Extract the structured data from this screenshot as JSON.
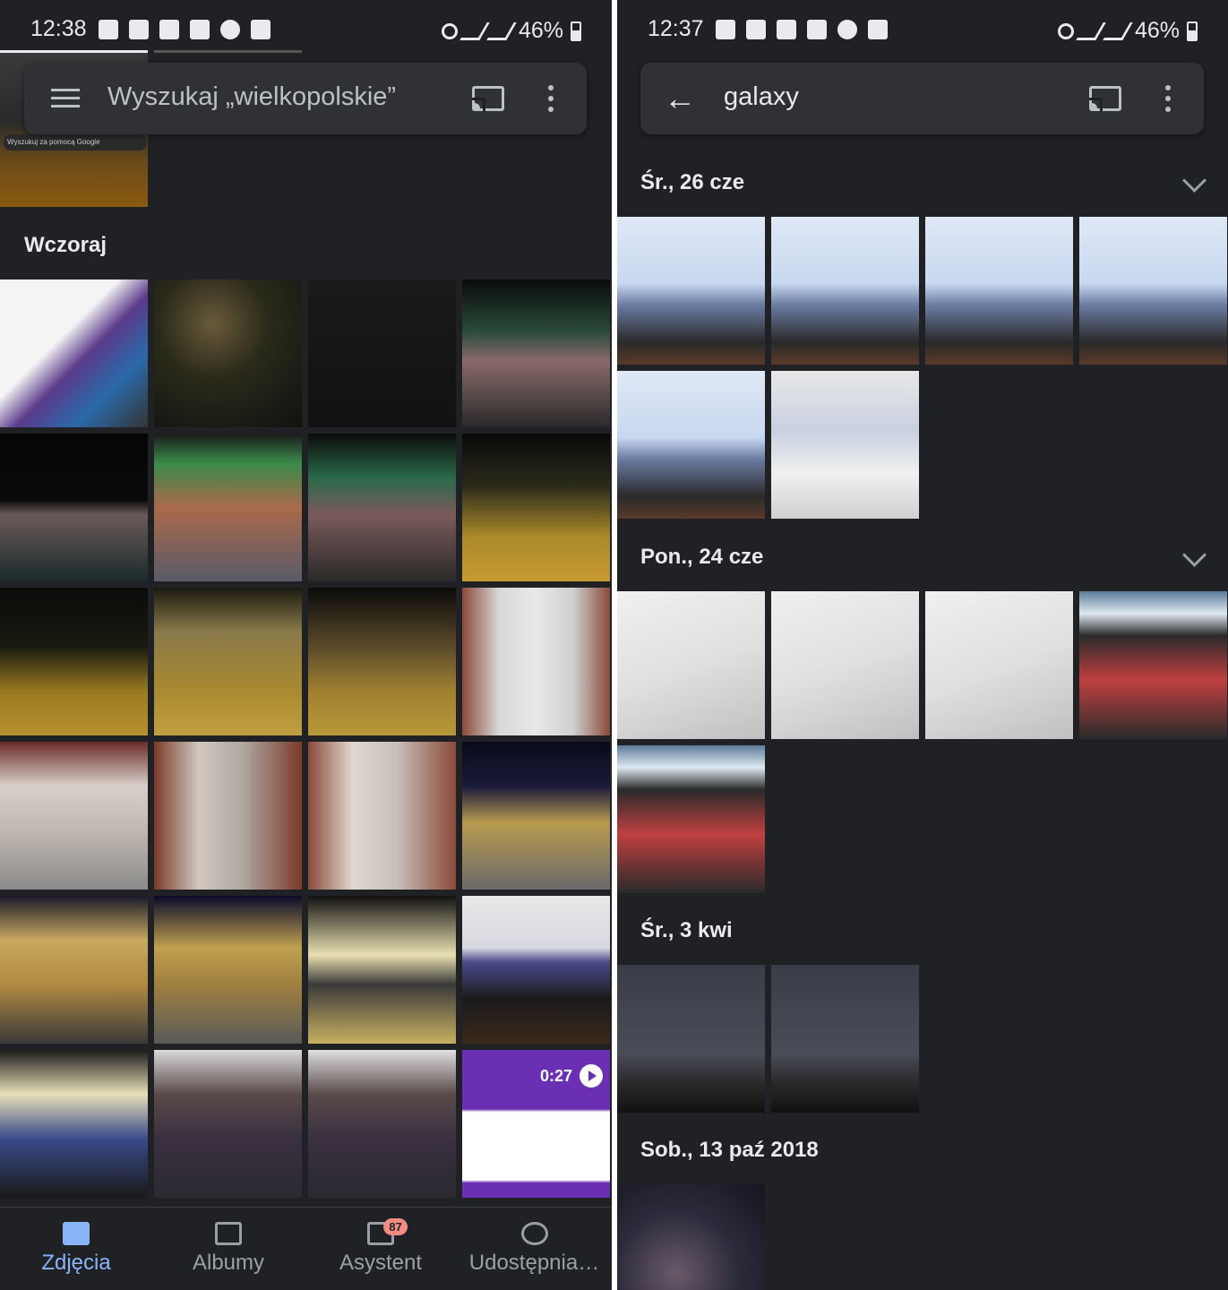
{
  "left": {
    "status": {
      "time": "12:38",
      "battery": "46%"
    },
    "search": {
      "placeholder": "Wyszukaj „wielkopolskie”"
    },
    "google_hint": "Wyszukuj za pomocą Google",
    "section": "Wczoraj",
    "thumbnails": [
      "phones-promo",
      "night-trees",
      "night-dark",
      "gas-station-night",
      "gas-station-far",
      "gas-station-amic",
      "gas-station-night-2",
      "station-square-cars",
      "square-night-1",
      "square-car-1",
      "square-car-2",
      "station-hall-1",
      "station-hall-2",
      "station-hall-3",
      "station-hall-4",
      "station-building-night",
      "station-entrance-1",
      "station-entrance-2",
      "train-1",
      "train-2",
      "train-3",
      "train-seats-1",
      "train-seats-2",
      "video-article"
    ],
    "video_duration": "0:27",
    "nav": [
      {
        "label": "Zdjęcia",
        "icon": "photos-icon"
      },
      {
        "label": "Albumy",
        "icon": "albums-icon"
      },
      {
        "label": "Asystent",
        "icon": "assistant-icon",
        "badge": "87"
      },
      {
        "label": "Udostępnia…",
        "icon": "sharing-icon"
      }
    ]
  },
  "right": {
    "status": {
      "time": "12:37",
      "battery": "46%"
    },
    "search": {
      "query": "galaxy"
    },
    "groups": [
      {
        "date": "Śr., 26 cze",
        "count": 6,
        "collapsible": true
      },
      {
        "date": "Pon., 24 cze",
        "count": 5,
        "collapsible": true
      },
      {
        "date": "Śr., 3 kwi",
        "count": 2,
        "collapsible": false
      },
      {
        "date": "Sob., 13 paź 2018",
        "count": 1,
        "collapsible": false
      }
    ]
  },
  "colors": {
    "background": "#202124",
    "accent": "#8ab4f8",
    "badge": "#f28b82",
    "searchbar": "#303134"
  }
}
